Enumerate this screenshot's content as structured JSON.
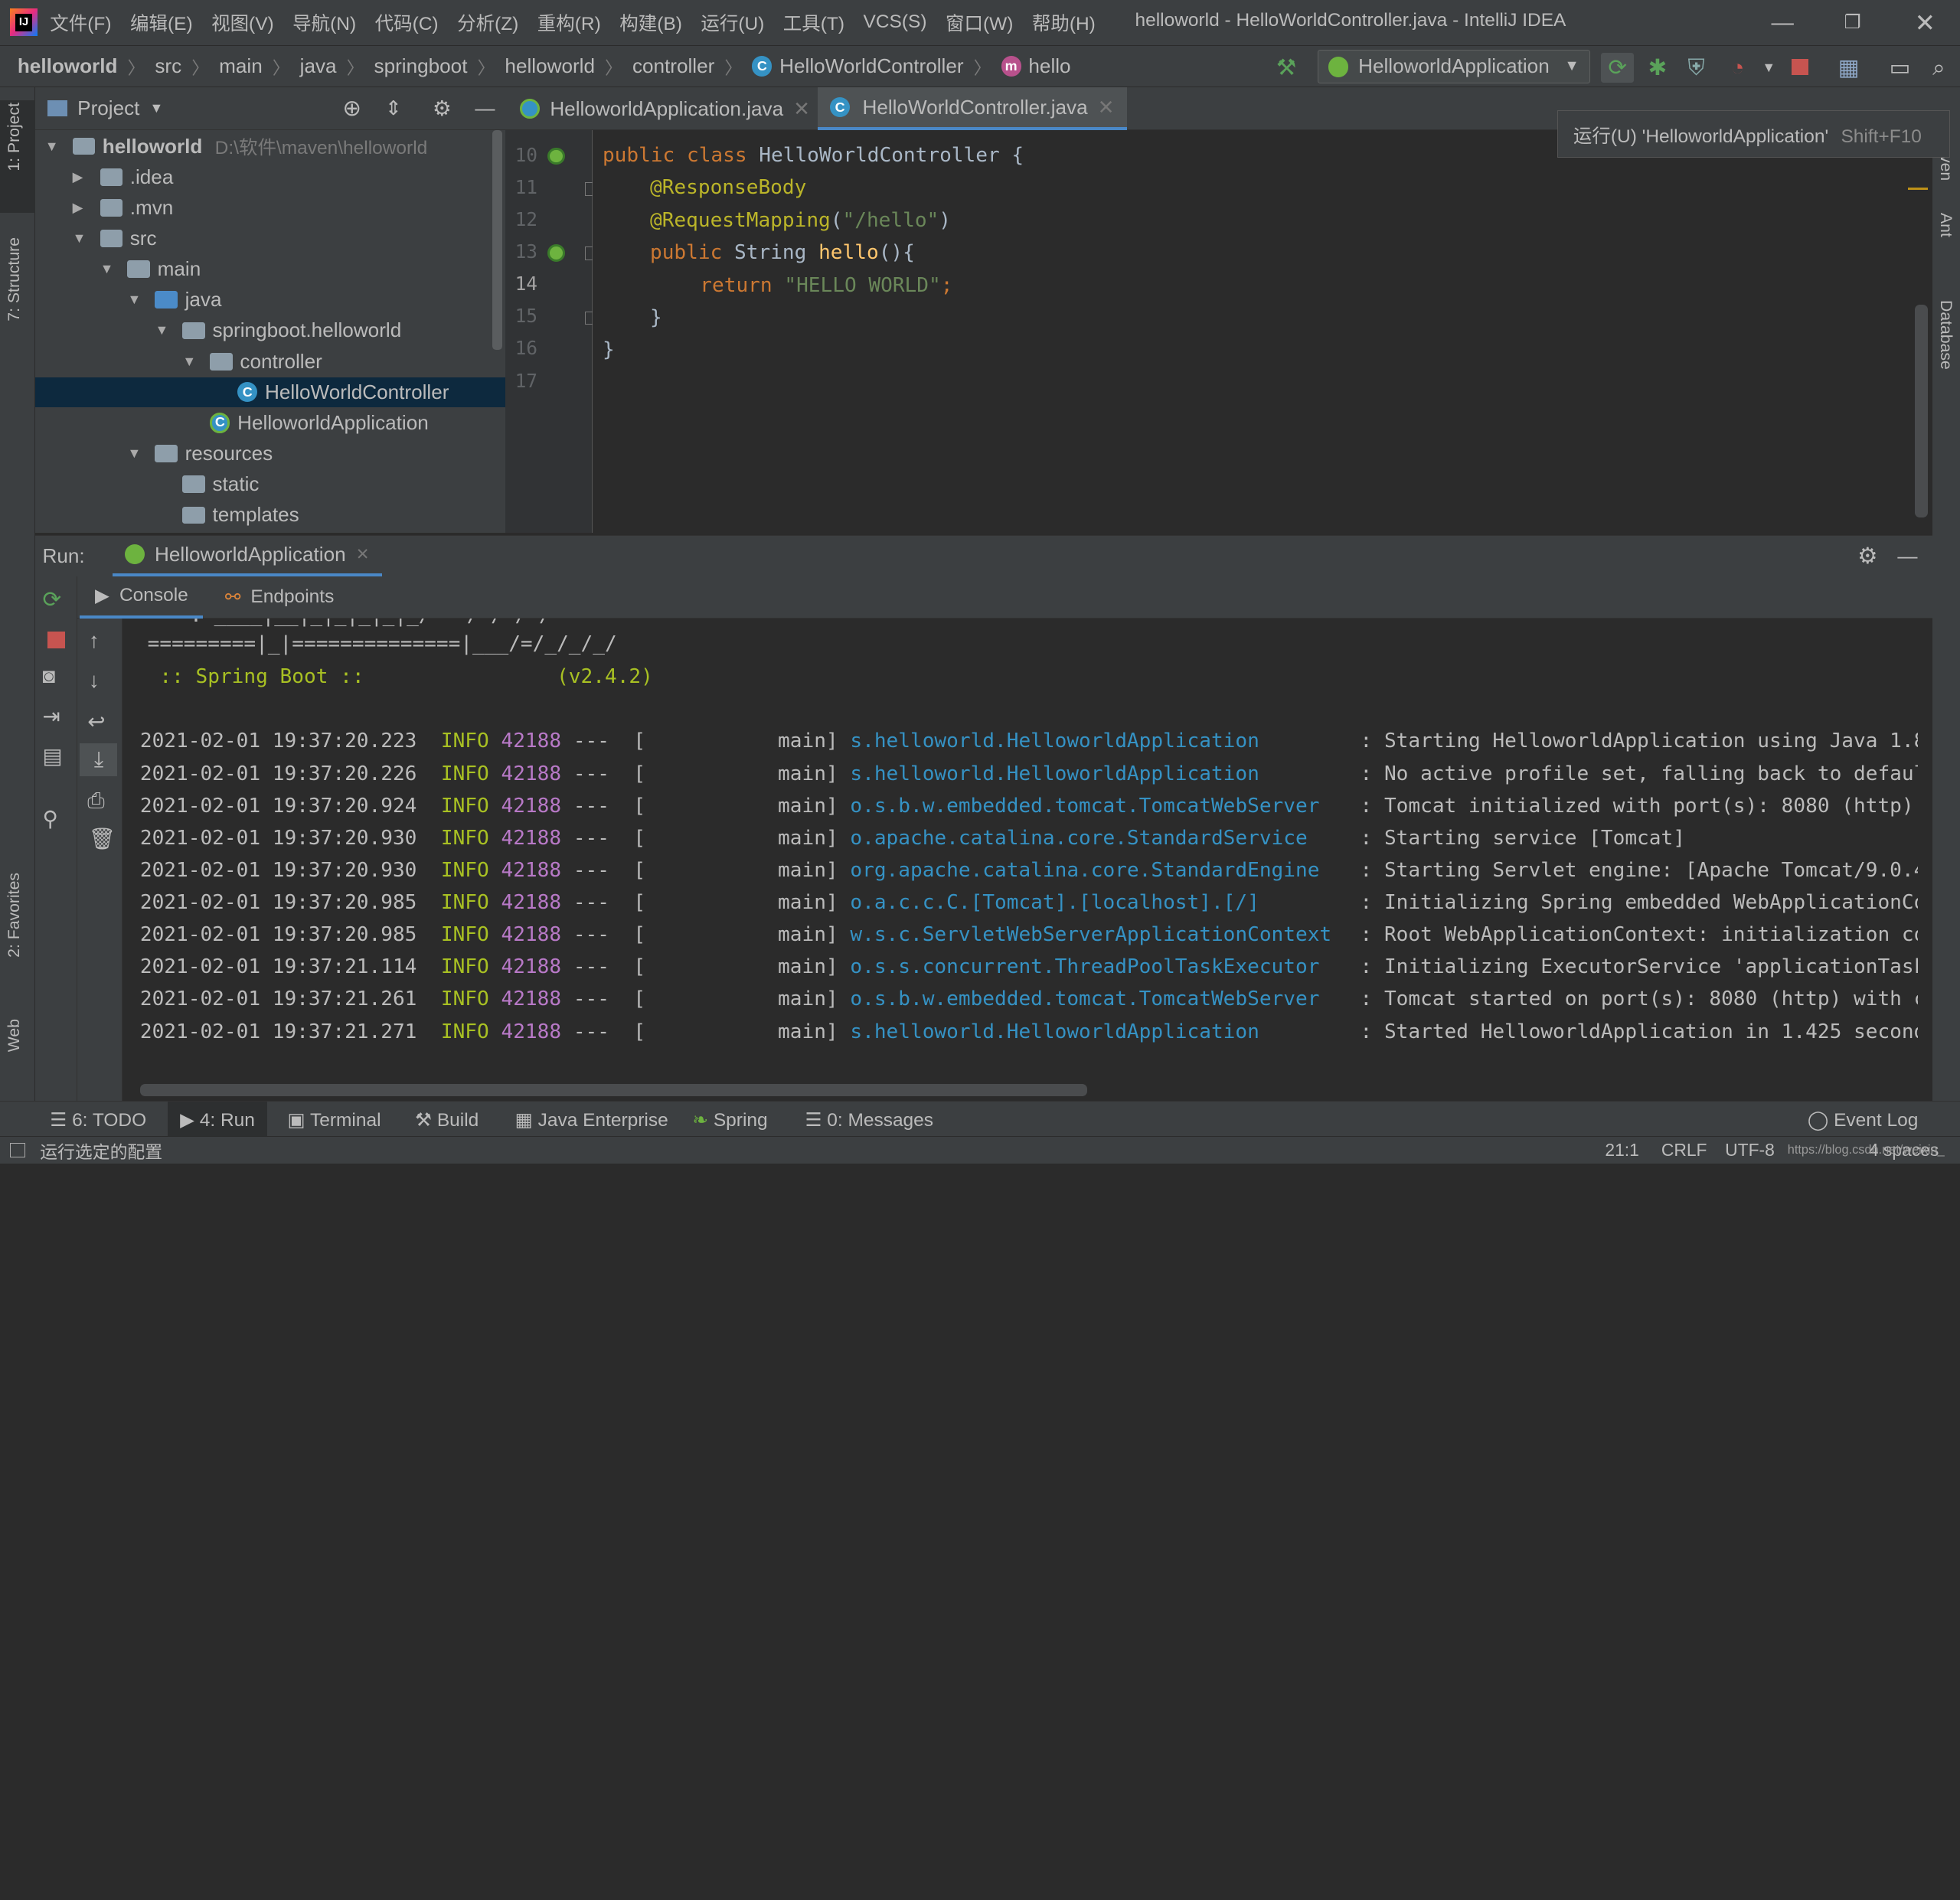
{
  "window": {
    "title": "helloworld - HelloWorldController.java - IntelliJ IDEA",
    "app_icon": "IJ"
  },
  "menu": [
    "文件(F)",
    "编辑(E)",
    "视图(V)",
    "导航(N)",
    "代码(C)",
    "分析(Z)",
    "重构(R)",
    "构建(B)",
    "运行(U)",
    "工具(T)",
    "VCS(S)",
    "窗口(W)",
    "帮助(H)"
  ],
  "breadcrumb": {
    "root": "helloworld",
    "parts": [
      "src",
      "main",
      "java",
      "springboot",
      "helloworld",
      "controller"
    ],
    "class_icon": "C",
    "class_name": "HelloWorldController",
    "method_icon": "m",
    "method_name": "hello"
  },
  "toolbar": {
    "run_config": "HelloworldApplication"
  },
  "left_strip": {
    "project": "1: Project",
    "structure": "7: Structure",
    "favorites": "2: Favorites",
    "web": "Web"
  },
  "right_strip": {
    "maven": "ven",
    "ant": "Ant",
    "database": "Database"
  },
  "project_panel": {
    "title": "Project",
    "tree": [
      {
        "label": "helloworld",
        "path": "D:\\软件\\maven\\helloworld",
        "depth": 0,
        "arrow": "▼",
        "type": "module"
      },
      {
        "label": ".idea",
        "depth": 1,
        "arrow": "▶",
        "type": "folder"
      },
      {
        "label": ".mvn",
        "depth": 1,
        "arrow": "▶",
        "type": "folder"
      },
      {
        "label": "src",
        "depth": 1,
        "arrow": "▼",
        "type": "folder"
      },
      {
        "label": "main",
        "depth": 2,
        "arrow": "▼",
        "type": "folder"
      },
      {
        "label": "java",
        "depth": 3,
        "arrow": "▼",
        "type": "source"
      },
      {
        "label": "springboot.helloworld",
        "depth": 4,
        "arrow": "▼",
        "type": "package"
      },
      {
        "label": "controller",
        "depth": 5,
        "arrow": "▼",
        "type": "package"
      },
      {
        "label": "HelloWorldController",
        "depth": 6,
        "arrow": "",
        "type": "class",
        "selected": true
      },
      {
        "label": "HelloworldApplication",
        "depth": 5,
        "arrow": "",
        "type": "springclass"
      },
      {
        "label": "resources",
        "depth": 3,
        "arrow": "▼",
        "type": "resources"
      },
      {
        "label": "static",
        "depth": 4,
        "arrow": "",
        "type": "folder"
      },
      {
        "label": "templates",
        "depth": 4,
        "arrow": "",
        "type": "folder"
      }
    ]
  },
  "editor": {
    "tabs": [
      {
        "label": "HelloworldApplication.java",
        "active": false
      },
      {
        "label": "HelloWorldController.java",
        "active": true
      }
    ],
    "line_numbers": [
      "10",
      "11",
      "12",
      "13",
      "14",
      "15",
      "16",
      "17"
    ],
    "tooltip": {
      "text": "运行(U) 'HelloworldApplication'",
      "shortcut": "Shift+F10"
    },
    "code": {
      "l10_kw": "public class ",
      "l10_rest": "HelloWorldController {",
      "l11": "@ResponseBody",
      "l12_an": "@RequestMapping",
      "l12_p1": "(",
      "l12_str": "\"/hello\"",
      "l12_p2": ")",
      "l13_kw": "public ",
      "l13_type": "String ",
      "l13_fn": "hello",
      "l13_rest": "(){",
      "l14_kw": "return ",
      "l14_str": "\"HELLO WORLD\"",
      "l14_semi": ";",
      "l15": "}",
      "l16": "}"
    }
  },
  "run_panel": {
    "label": "Run:",
    "config": "HelloworldApplication",
    "tabs": [
      "Console",
      "Endpoints"
    ],
    "banner": [
      "=========|_|==============|___/=/_/_/_/",
      " :: Spring Boot ::                (v2.4.2)"
    ],
    "logs": [
      {
        "ts": "2021-02-01 19:37:20.223",
        "lvl": "INFO",
        "pid": "42188",
        "thread": "---  [           main]",
        "logger": "s.helloworld.HelloworldApplication",
        "msg": ": Starting HelloworldApplication using Java 1.8"
      },
      {
        "ts": "2021-02-01 19:37:20.226",
        "lvl": "INFO",
        "pid": "42188",
        "thread": "---  [           main]",
        "logger": "s.helloworld.HelloworldApplication",
        "msg": ": No active profile set, falling back to defaul"
      },
      {
        "ts": "2021-02-01 19:37:20.924",
        "lvl": "INFO",
        "pid": "42188",
        "thread": "---  [           main]",
        "logger": "o.s.b.w.embedded.tomcat.TomcatWebServer",
        "msg": ": Tomcat initialized with port(s): 8080 (http)"
      },
      {
        "ts": "2021-02-01 19:37:20.930",
        "lvl": "INFO",
        "pid": "42188",
        "thread": "---  [           main]",
        "logger": "o.apache.catalina.core.StandardService",
        "msg": ": Starting service [Tomcat]"
      },
      {
        "ts": "2021-02-01 19:37:20.930",
        "lvl": "INFO",
        "pid": "42188",
        "thread": "---  [           main]",
        "logger": "org.apache.catalina.core.StandardEngine",
        "msg": ": Starting Servlet engine: [Apache Tomcat/9.0.4"
      },
      {
        "ts": "2021-02-01 19:37:20.985",
        "lvl": "INFO",
        "pid": "42188",
        "thread": "---  [           main]",
        "logger": "o.a.c.c.C.[Tomcat].[localhost].[/]",
        "msg": ": Initializing Spring embedded WebApplicationCo"
      },
      {
        "ts": "2021-02-01 19:37:20.985",
        "lvl": "INFO",
        "pid": "42188",
        "thread": "---  [           main]",
        "logger": "w.s.c.ServletWebServerApplicationContext",
        "msg": ": Root WebApplicationContext: initialization co"
      },
      {
        "ts": "2021-02-01 19:37:21.114",
        "lvl": "INFO",
        "pid": "42188",
        "thread": "---  [           main]",
        "logger": "o.s.s.concurrent.ThreadPoolTaskExecutor",
        "msg": ": Initializing ExecutorService 'applicationTask"
      },
      {
        "ts": "2021-02-01 19:37:21.261",
        "lvl": "INFO",
        "pid": "42188",
        "thread": "---  [           main]",
        "logger": "o.s.b.w.embedded.tomcat.TomcatWebServer",
        "msg": ": Tomcat started on port(s): 8080 (http) with c"
      },
      {
        "ts": "2021-02-01 19:37:21.271",
        "lvl": "INFO",
        "pid": "42188",
        "thread": "---  [           main]",
        "logger": "s.helloworld.HelloworldApplication",
        "msg": ": Started HelloworldApplication in 1.425 second"
      }
    ]
  },
  "bottom_tabs": [
    "6: TODO",
    "4: Run",
    "Terminal",
    "Build",
    "Java Enterprise",
    "Spring",
    "0: Messages"
  ],
  "event_log": "Event Log",
  "status": {
    "message": "运行选定的配置",
    "position": "21:1",
    "line_sep": "CRLF",
    "encoding": "UTF-8",
    "indent": "4 spaces",
    "watermark": "https://blog.csdn.net/weixin_"
  },
  "colors": {
    "keyword": "#cc7832",
    "annotation": "#bbb529",
    "string": "#6a8759",
    "function": "#ffc66d",
    "logger": "#3592c4",
    "info": "#a8c023",
    "pid": "#b879c7",
    "selection": "#0d293e",
    "accent": "#4a88c7"
  }
}
